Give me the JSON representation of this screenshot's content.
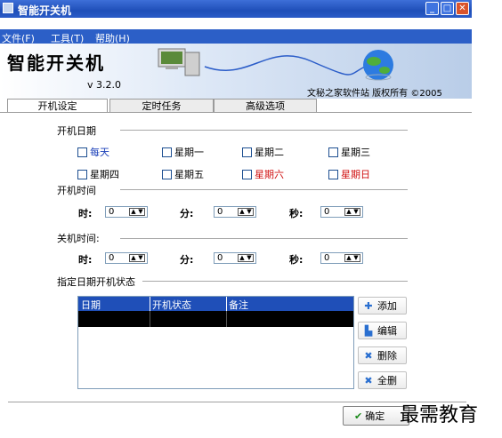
{
  "window": {
    "title": "智能开关机"
  },
  "menu": [
    "文件(F)",
    "工具(T)",
    "帮助(H)"
  ],
  "banner": {
    "logo": "智能开关机",
    "version": "v 3.2.0",
    "copyright": "文秘之家软件站 版权所有 ©2005"
  },
  "tabs": [
    "开机设定",
    "定时任务",
    "高级选项"
  ],
  "boot_days": {
    "title": "开机日期",
    "options": [
      "每天",
      "星期一",
      "星期二",
      "星期三",
      "星期四",
      "星期五",
      "星期六",
      "星期日"
    ]
  },
  "boot_time": {
    "title": "开机时间",
    "hour_label": "时:",
    "minute_label": "分:",
    "second_label": "秒:",
    "hour": "0",
    "minute": "0",
    "second": "0"
  },
  "shutdown_time": {
    "title": "关机时间:",
    "hour_label": "时:",
    "minute_label": "分:",
    "second_label": "秒:",
    "hour": "0",
    "minute": "0",
    "second": "0"
  },
  "date_status": {
    "title": "指定日期开机状态",
    "columns": [
      "日期",
      "开机状态",
      "备注"
    ]
  },
  "actions": {
    "add": "添加",
    "edit": "编辑",
    "delete": "删除",
    "delete_all": "全删"
  },
  "ok": "确定",
  "watermark": "最需教育",
  "colors": {
    "titlebar": "#2a5cc8",
    "weekday_blue": "#1a3fb8",
    "weekend_red": "#d01010"
  }
}
